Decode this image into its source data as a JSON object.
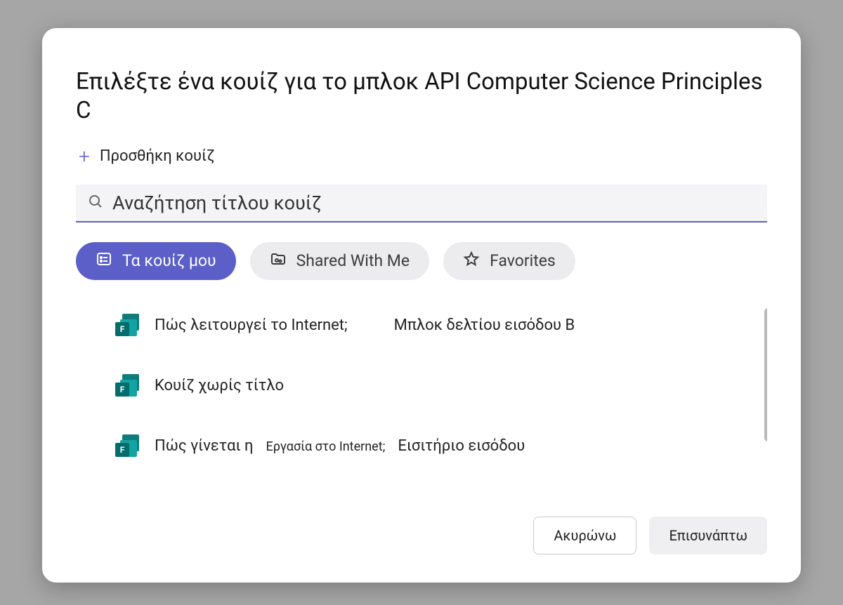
{
  "modal": {
    "title": "Επιλέξτε ένα κουίζ για το μπλοκ API Computer Science Principles C",
    "add_quiz_label": "Προσθήκη κουίζ"
  },
  "search": {
    "placeholder": "Αναζήτηση τίτλου κουίζ",
    "value": ""
  },
  "tabs": {
    "my_quizzes": "Τα κουίζ μου",
    "shared": "Shared With Me",
    "favorites": "Favorites"
  },
  "quizzes": [
    {
      "title_a": "Πώς λειτουργεί το Internet;",
      "title_b": "",
      "title_c": "Μπλοκ δελτίου εισόδου Β"
    },
    {
      "title_a": "Κουίζ χωρίς τίτλο",
      "title_b": "",
      "title_c": ""
    },
    {
      "title_a": "Πώς γίνεται η",
      "title_b": "Εργασία στο Internet;",
      "title_c": "Εισιτήριο εισόδου"
    }
  ],
  "footer": {
    "cancel": "Ακυρώνω",
    "attach": "Επισυνάπτω"
  },
  "icons": {
    "forms_letter": "F"
  }
}
